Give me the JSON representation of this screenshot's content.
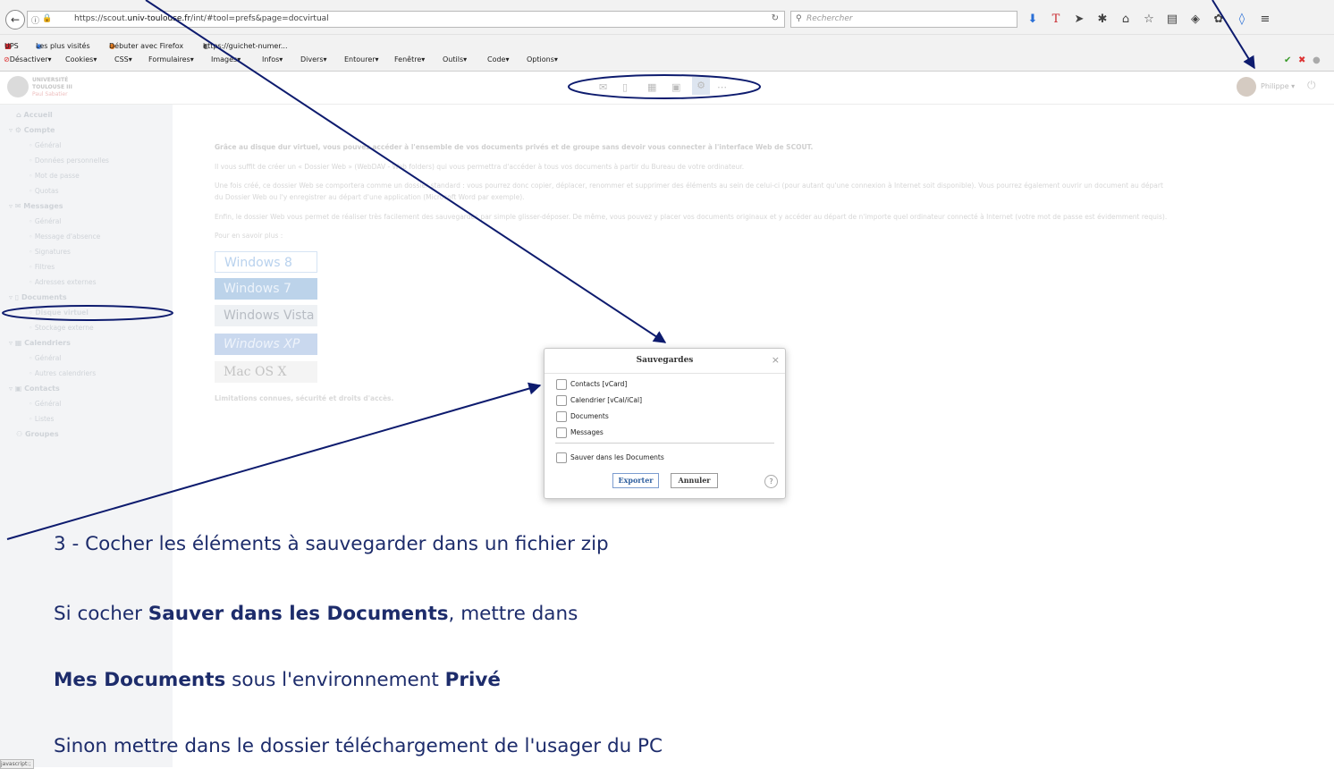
{
  "browser": {
    "url_prefix": "https://scout.",
    "url_domain": "univ-toulouse.fr",
    "url_suffix": "/int/#tool=prefs&page=docvirtual",
    "search_placeholder": "Rechercher",
    "bookmarks": [
      "UPS",
      "Les plus visités",
      "Débuter avec Firefox",
      "https://guichet-numer..."
    ],
    "dev_menus": [
      "Désactiver▾",
      "Cookies▾",
      "CSS▾",
      "Formulaires▾",
      "Images▾",
      "Infos▾",
      "Divers▾",
      "Entourer▾",
      "Fenêtre▾",
      "Outils▾",
      "Code▾",
      "Options▾"
    ],
    "toolbar_icons": [
      "download-icon",
      "t-icon",
      "send-icon",
      "pocket-icon",
      "home-icon",
      "star-icon",
      "reader-icon",
      "shield-icon",
      "extension-icon",
      "drop-icon",
      "menu-icon"
    ]
  },
  "app": {
    "logo_line1": "UNIVERSITÉ",
    "logo_line2": "TOULOUSE III",
    "logo_line3": "Paul Sabatier",
    "user_name": "Philippe ▾"
  },
  "sidebar": {
    "items": [
      {
        "label": "Accueil",
        "type": "sec"
      },
      {
        "label": "Compte",
        "type": "sec"
      },
      {
        "label": "Général",
        "type": "sub"
      },
      {
        "label": "Données personnelles",
        "type": "sub"
      },
      {
        "label": "Mot de passe",
        "type": "sub"
      },
      {
        "label": "Quotas",
        "type": "sub"
      },
      {
        "label": "Messages",
        "type": "sec"
      },
      {
        "label": "Général",
        "type": "sub"
      },
      {
        "label": "Message d'absence",
        "type": "sub"
      },
      {
        "label": "Signatures",
        "type": "sub"
      },
      {
        "label": "Filtres",
        "type": "sub"
      },
      {
        "label": "Adresses externes",
        "type": "sub"
      },
      {
        "label": "Documents",
        "type": "sec"
      },
      {
        "label": "Disque virtuel",
        "type": "sub"
      },
      {
        "label": "Stockage externe",
        "type": "sub"
      },
      {
        "label": "Calendriers",
        "type": "sec"
      },
      {
        "label": "Général",
        "type": "sub"
      },
      {
        "label": "Autres calendriers",
        "type": "sub"
      },
      {
        "label": "Contacts",
        "type": "sec"
      },
      {
        "label": "Général",
        "type": "sub"
      },
      {
        "label": "Listes",
        "type": "sub"
      },
      {
        "label": "Groupes",
        "type": "sec"
      }
    ]
  },
  "content": {
    "intro": "Grâce au disque dur virtuel, vous pouvez accéder à l'ensemble de vos documents privés et de groupe sans devoir vous connecter à l'interface Web de SCOUT.",
    "p1": "Il vous suffit de créer un « Dossier Web » (WebDAV - Web folders) qui vous permettra d'accéder à tous vos documents à partir du Bureau de votre ordinateur.",
    "p2a": "Une fois créé, ce dossier Web se comportera comme un dossier standard : vous pourrez donc copier, déplacer, renommer et supprimer des éléments au sein de celui-ci (pour autant qu'une connexion à Internet soit disponible). Vous pourrez également ouvrir un document au départ",
    "p2b": "du Dossier Web ou l'y enregistrer au départ d'une application (Microsoft Word par exemple).",
    "p3": "Enfin, le dossier Web vous permet de réaliser très facilement des sauvegardes par simple glisser-déposer. De même, vous pouvez y placer vos documents originaux et y accéder au départ de n'importe quel ordinateur connecté à Internet (votre mot de passe est évidemment requis).",
    "more": "Pour en savoir plus :",
    "os_buttons": [
      "Windows 8",
      "Windows 7",
      "Windows Vista",
      "Windows XP",
      "Mac OS X"
    ],
    "limits": "Limitations connues, sécurité et droits d'accès."
  },
  "modal": {
    "title": "Sauvegardes",
    "options": [
      "Contacts [vCard]",
      "Calendrier [vCal/iCal]",
      "Documents",
      "Messages"
    ],
    "save_in_docs": "Sauver dans les Documents",
    "export_label": "Exporter",
    "cancel_label": "Annuler"
  },
  "annotations": {
    "step3": "3 - Cocher les éléments à sauvegarder dans un fichier zip",
    "line2_pre": "Si cocher ",
    "line2_bold": "Sauver dans les Documents",
    "line2_post": ", mettre dans",
    "line3_bold1": "Mes Documents",
    "line3_mid": " sous l'environnement ",
    "line3_bold2": "Privé",
    "line4": "Sinon mettre dans le dossier téléchargement de l'usager du PC"
  },
  "status_text": "javascript:;",
  "colors": {
    "annotation": "#1d2c6b",
    "arrow": "#0d1b6e",
    "export_text": "#2e5e9e"
  }
}
